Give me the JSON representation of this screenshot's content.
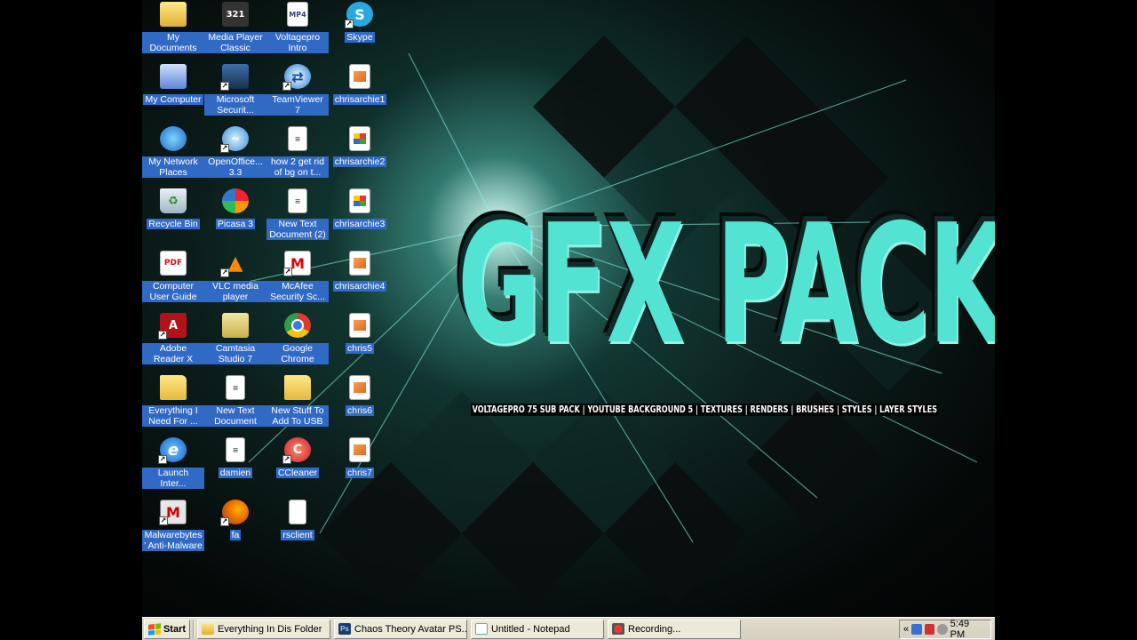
{
  "wallpaper": {
    "title": "GFX PACK",
    "subtitle": "VOLTAGEPRO 75 SUB PACK | YOUTUBE BACKGROUND 5 | TEXTURES | RENDERS | BRUSHES | STYLES | LAYER STYLES"
  },
  "desktop_icons": {
    "my_documents": "My Documents",
    "my_computer": "My Computer",
    "my_network": "My Network Places",
    "recycle_bin": "Recycle Bin",
    "computer_guide": "Computer User Guide",
    "adobe_reader": "Adobe Reader X",
    "everything_folder": "Everything I Need For ...",
    "launch_ie": "Launch Inter...",
    "malwarebytes": "Malwarebytes' Anti-Malware",
    "media_player": "Media Player Classic",
    "microsoft_security": "Microsoft Securit...",
    "openoffice": "OpenOffice... 3.3",
    "picasa": "Picasa 3",
    "vlc": "VLC media player",
    "camtasia": "Camtasia Studio 7",
    "new_text_document": "New Text Document",
    "damien": "damien",
    "fa": "fa",
    "voltagepro_intro": "Voltageprо Intro",
    "teamviewer": "TeamViewer 7",
    "how2": "how 2 get rid of bg on t...",
    "new_text_document_2": "New Text Document (2)",
    "mcafee": "McAfee Security Sc...",
    "chrome": "Google Chrome",
    "new_stuff": "New Stuff To Add To USB",
    "ccleaner": "CCleaner",
    "rsclient": "rsclient",
    "skype": "Skype",
    "chrisarchie1": "chrisarchie1",
    "chrisarchie2": "chrisarchie2",
    "chrisarchie3": "chrisarchie3",
    "chrisarchie4": "chrisarchie4",
    "chris5": "chris5",
    "chris6": "chris6",
    "chris7": "chris7"
  },
  "taskbar": {
    "start": "Start",
    "tasks": [
      "Everything In Dis Folder",
      "Chaos Theory Avatar PS...",
      "Untitled - Notepad",
      "Recording..."
    ],
    "tray_arrow": "«",
    "clock": "5:49 PM"
  },
  "colors": {
    "selection": "#316ac5",
    "accent_teal": "#52e3d2",
    "taskbar": "#d4d0c8"
  }
}
